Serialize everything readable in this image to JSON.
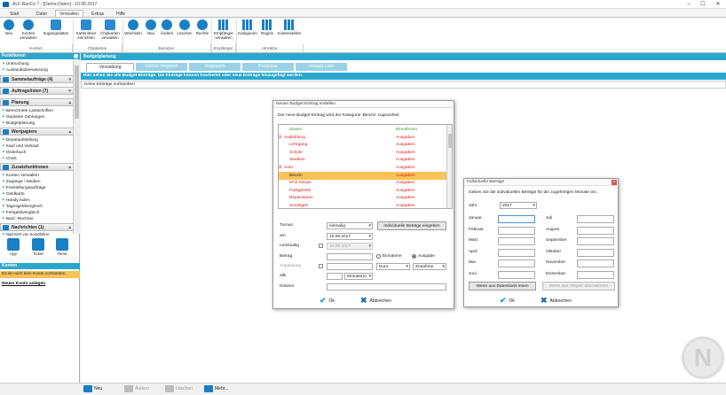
{
  "window": {
    "title": "ALF-BanCo 7 - [Demo-Daten] - 10.08.2017",
    "min": "–",
    "max": "☐",
    "close": "✕"
  },
  "menu_tabs": [
    {
      "label": "Start",
      "active": false
    },
    {
      "label": "Datei",
      "active": false
    },
    {
      "label": "Verwalten",
      "active": true
    },
    {
      "label": "Extras",
      "active": false
    },
    {
      "label": "Hilfe",
      "active": false
    }
  ],
  "ribbon": {
    "buttons": [
      "Neu",
      "Konten\nverwalten",
      "Zugangsdaten",
      "Kartenleser\neinrichten",
      "Chipkarten\nverwalten",
      "Wechseln",
      "Neu",
      "Ändern",
      "Löschen",
      "Rechte",
      "Empfänger\nverwalten",
      "Kategorien",
      "Regeln",
      "Kostenstellen"
    ],
    "groups": [
      "Konten",
      "Chipkarten",
      "Benutzer",
      "Empfänger",
      "Umsätze"
    ]
  },
  "left": {
    "header": "Funktionen",
    "top_items": [
      "Umbuchung",
      "Auslandsüberweisung"
    ],
    "sections": {
      "sammel": "Sammelaufträge (4)",
      "auftrag": "Auftragslisten (7)",
      "planung": "Planung",
      "wert": "Wertpapiere",
      "zusatz": "Zusatzfunktionen",
      "nachr": "Nachrichten (1)"
    },
    "planung_items": [
      "Berechnete Lastschriften",
      "Geplante Zahlungen",
      "Budgetplanung"
    ],
    "wert_items": [
      "Depotaufstellung",
      "Kauf und Verkauf",
      "Orderbuch",
      "Chart"
    ],
    "zusatz_items": [
      "Konten verwalten",
      "Zugänge / Medien",
      "Freistellungsaufträge",
      "Geldkarte",
      "Handy laden",
      "Tagesgeldvergleich",
      "Festgeldvergleich",
      "Bauf.-Rechner"
    ],
    "nachr_item": "Nachricht von Kontoführer",
    "apps": [
      "App",
      "Ticker",
      "Filme"
    ],
    "konten_header": "Konten",
    "konten_msg": "Es ist noch kein Konto vorhanden.",
    "konten_link": "Neues Konto anlegen"
  },
  "main": {
    "header": "Budgetplanung",
    "tabs": [
      "Verwaltung",
      "Soll-Ist-Vergleich",
      "Diagramm",
      "Prognose",
      "Umsatz-Liste"
    ],
    "info": "Hier sehen Sie alle Budget-Einträge. Die Einträge können bearbeitet oder neue Einträge hinzugefügt werden.",
    "empty": "Keine Einträge vorhanden!"
  },
  "dialog1": {
    "title": "Neuen Budget-Eintrag erstellen",
    "intro": "Der neue Budget-Eintrag wird der Kategorie 'Benzin' zugeordnet.",
    "tree": [
      {
        "name": "Zinsen",
        "type": "Einnahmen",
        "color": "#2e9a2e",
        "indent": 1,
        "hl": false
      },
      {
        "name": "Ausbildung",
        "type": "Ausgaben",
        "color": "#d62020",
        "indent": 0,
        "hl": false
      },
      {
        "name": "Lehrgang",
        "type": "Ausgaben",
        "color": "#d62020",
        "indent": 1,
        "hl": false
      },
      {
        "name": "Schule",
        "type": "Ausgaben",
        "color": "#d62020",
        "indent": 1,
        "hl": false
      },
      {
        "name": "Studium",
        "type": "Ausgaben",
        "color": "#d62020",
        "indent": 1,
        "hl": false
      },
      {
        "name": "Auto",
        "type": "Ausgaben",
        "color": "#d62020",
        "indent": 0,
        "hl": false
      },
      {
        "name": "Benzin",
        "type": "Ausgaben",
        "color": "#222222",
        "indent": 1,
        "hl": true
      },
      {
        "name": "KFZ-Steuer",
        "type": "Ausgaben",
        "color": "#d62020",
        "indent": 1,
        "hl": false
      },
      {
        "name": "Parkgebühr",
        "type": "Ausgaben",
        "color": "#d62020",
        "indent": 1,
        "hl": false
      },
      {
        "name": "Reparaturen",
        "type": "Ausgaben",
        "color": "#d62020",
        "indent": 1,
        "hl": false
      },
      {
        "name": "Sonstiges",
        "type": "Ausgaben",
        "color": "#d62020",
        "indent": 1,
        "hl": false
      }
    ],
    "turnus_label": "Turnus",
    "turnus_value": "einmalig",
    "indiv_button": "Individuelle Beträge eingeben",
    "am_label": "am",
    "am_value": "10.08.2017",
    "letzt_label": "Letztmalig",
    "letzt_value": "10.08.2017",
    "betrag_label": "Betrag",
    "einnahme": "Einnahme",
    "ausgabe": "Ausgabe",
    "anpassung_label": "Anpassung",
    "currency": "Euro",
    "zunahme": "Zunahme",
    "alle_label": "alle",
    "monate": "Monate(n)",
    "notizen_label": "Notizen",
    "ok": "Ok",
    "cancel": "Abbrechen"
  },
  "dialog2": {
    "title": "Individuelle Beträge",
    "intro": "Geben Sie die individuellen Beträge für die zugehörigen Monate ein.",
    "jahr_label": "Jahr",
    "jahr_value": "2017",
    "months_left": [
      "Januar",
      "Februar",
      "März",
      "April",
      "Mai",
      "Juni"
    ],
    "months_right": [
      "Juli",
      "August",
      "September",
      "Oktober",
      "November",
      "Dezember"
    ],
    "btn_read": "Werte aus Datenbank lesen",
    "btn_copy": "Werte aus Vorjahr übernehmen",
    "ok": "Ok",
    "cancel": "Abbrechen"
  },
  "bottom": {
    "neu": "Neu",
    "andern": "Ändern",
    "loschen": "Löschen",
    "mehr": "Mehr..."
  },
  "watermark": "N"
}
